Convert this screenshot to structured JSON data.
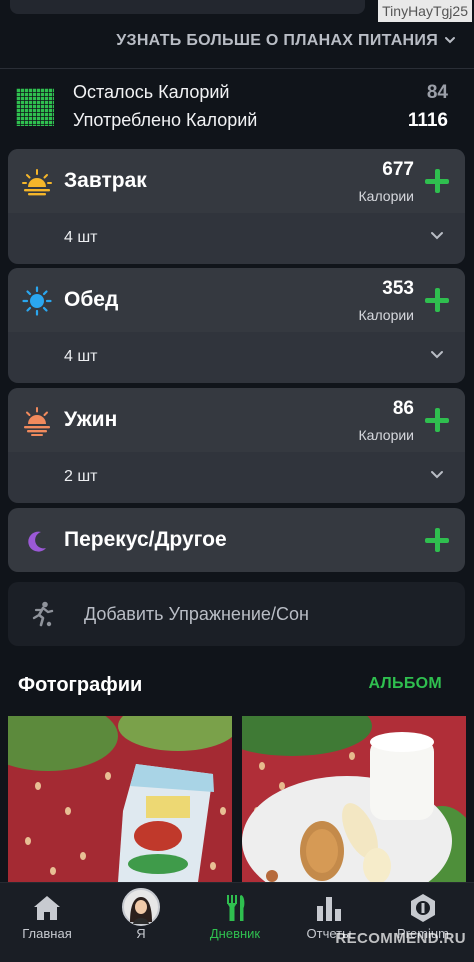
{
  "watermark_top": "TinyHayTgj25",
  "header": {
    "plans_link": "УЗНАТЬ БОЛЬШЕ О ПЛАНАХ ПИТАНИЯ"
  },
  "summary": {
    "remaining_label": "Осталось Калорий",
    "remaining_value": "84",
    "consumed_label": "Употреблено Калорий",
    "consumed_value": "1116"
  },
  "meals": [
    {
      "title": "Завтрак",
      "calories": "677",
      "unit": "Калории",
      "count": "4 шт",
      "icon": "sunrise-icon"
    },
    {
      "title": "Обед",
      "calories": "353",
      "unit": "Калории",
      "count": "4 шт",
      "icon": "sun-icon"
    },
    {
      "title": "Ужин",
      "calories": "86",
      "unit": "Калории",
      "count": "2 шт",
      "icon": "sunset-icon"
    }
  ],
  "snack": {
    "title": "Перекус/Другое",
    "icon": "moon-icon"
  },
  "exercise": {
    "label": "Добавить Упражнение/Сон",
    "icon": "running-person-icon"
  },
  "photos": {
    "title": "Фотографии",
    "album_link": "АЛЬБОМ"
  },
  "tabs": [
    {
      "label": "Главная",
      "icon": "home-icon",
      "active": false
    },
    {
      "label": "Я",
      "icon": "avatar",
      "active": false
    },
    {
      "label": "Дневник",
      "icon": "diary-cutlery-icon",
      "active": true
    },
    {
      "label": "Отчеты",
      "icon": "bar-chart-icon",
      "active": false
    },
    {
      "label": "Premium",
      "icon": "premium-badge-icon",
      "active": false
    }
  ],
  "watermark_bottom": "RECOMMEND.RU",
  "colors": {
    "accent_green": "#2fbf4f",
    "background": "#10141a",
    "card": "#30343c",
    "card_header": "#353940"
  }
}
